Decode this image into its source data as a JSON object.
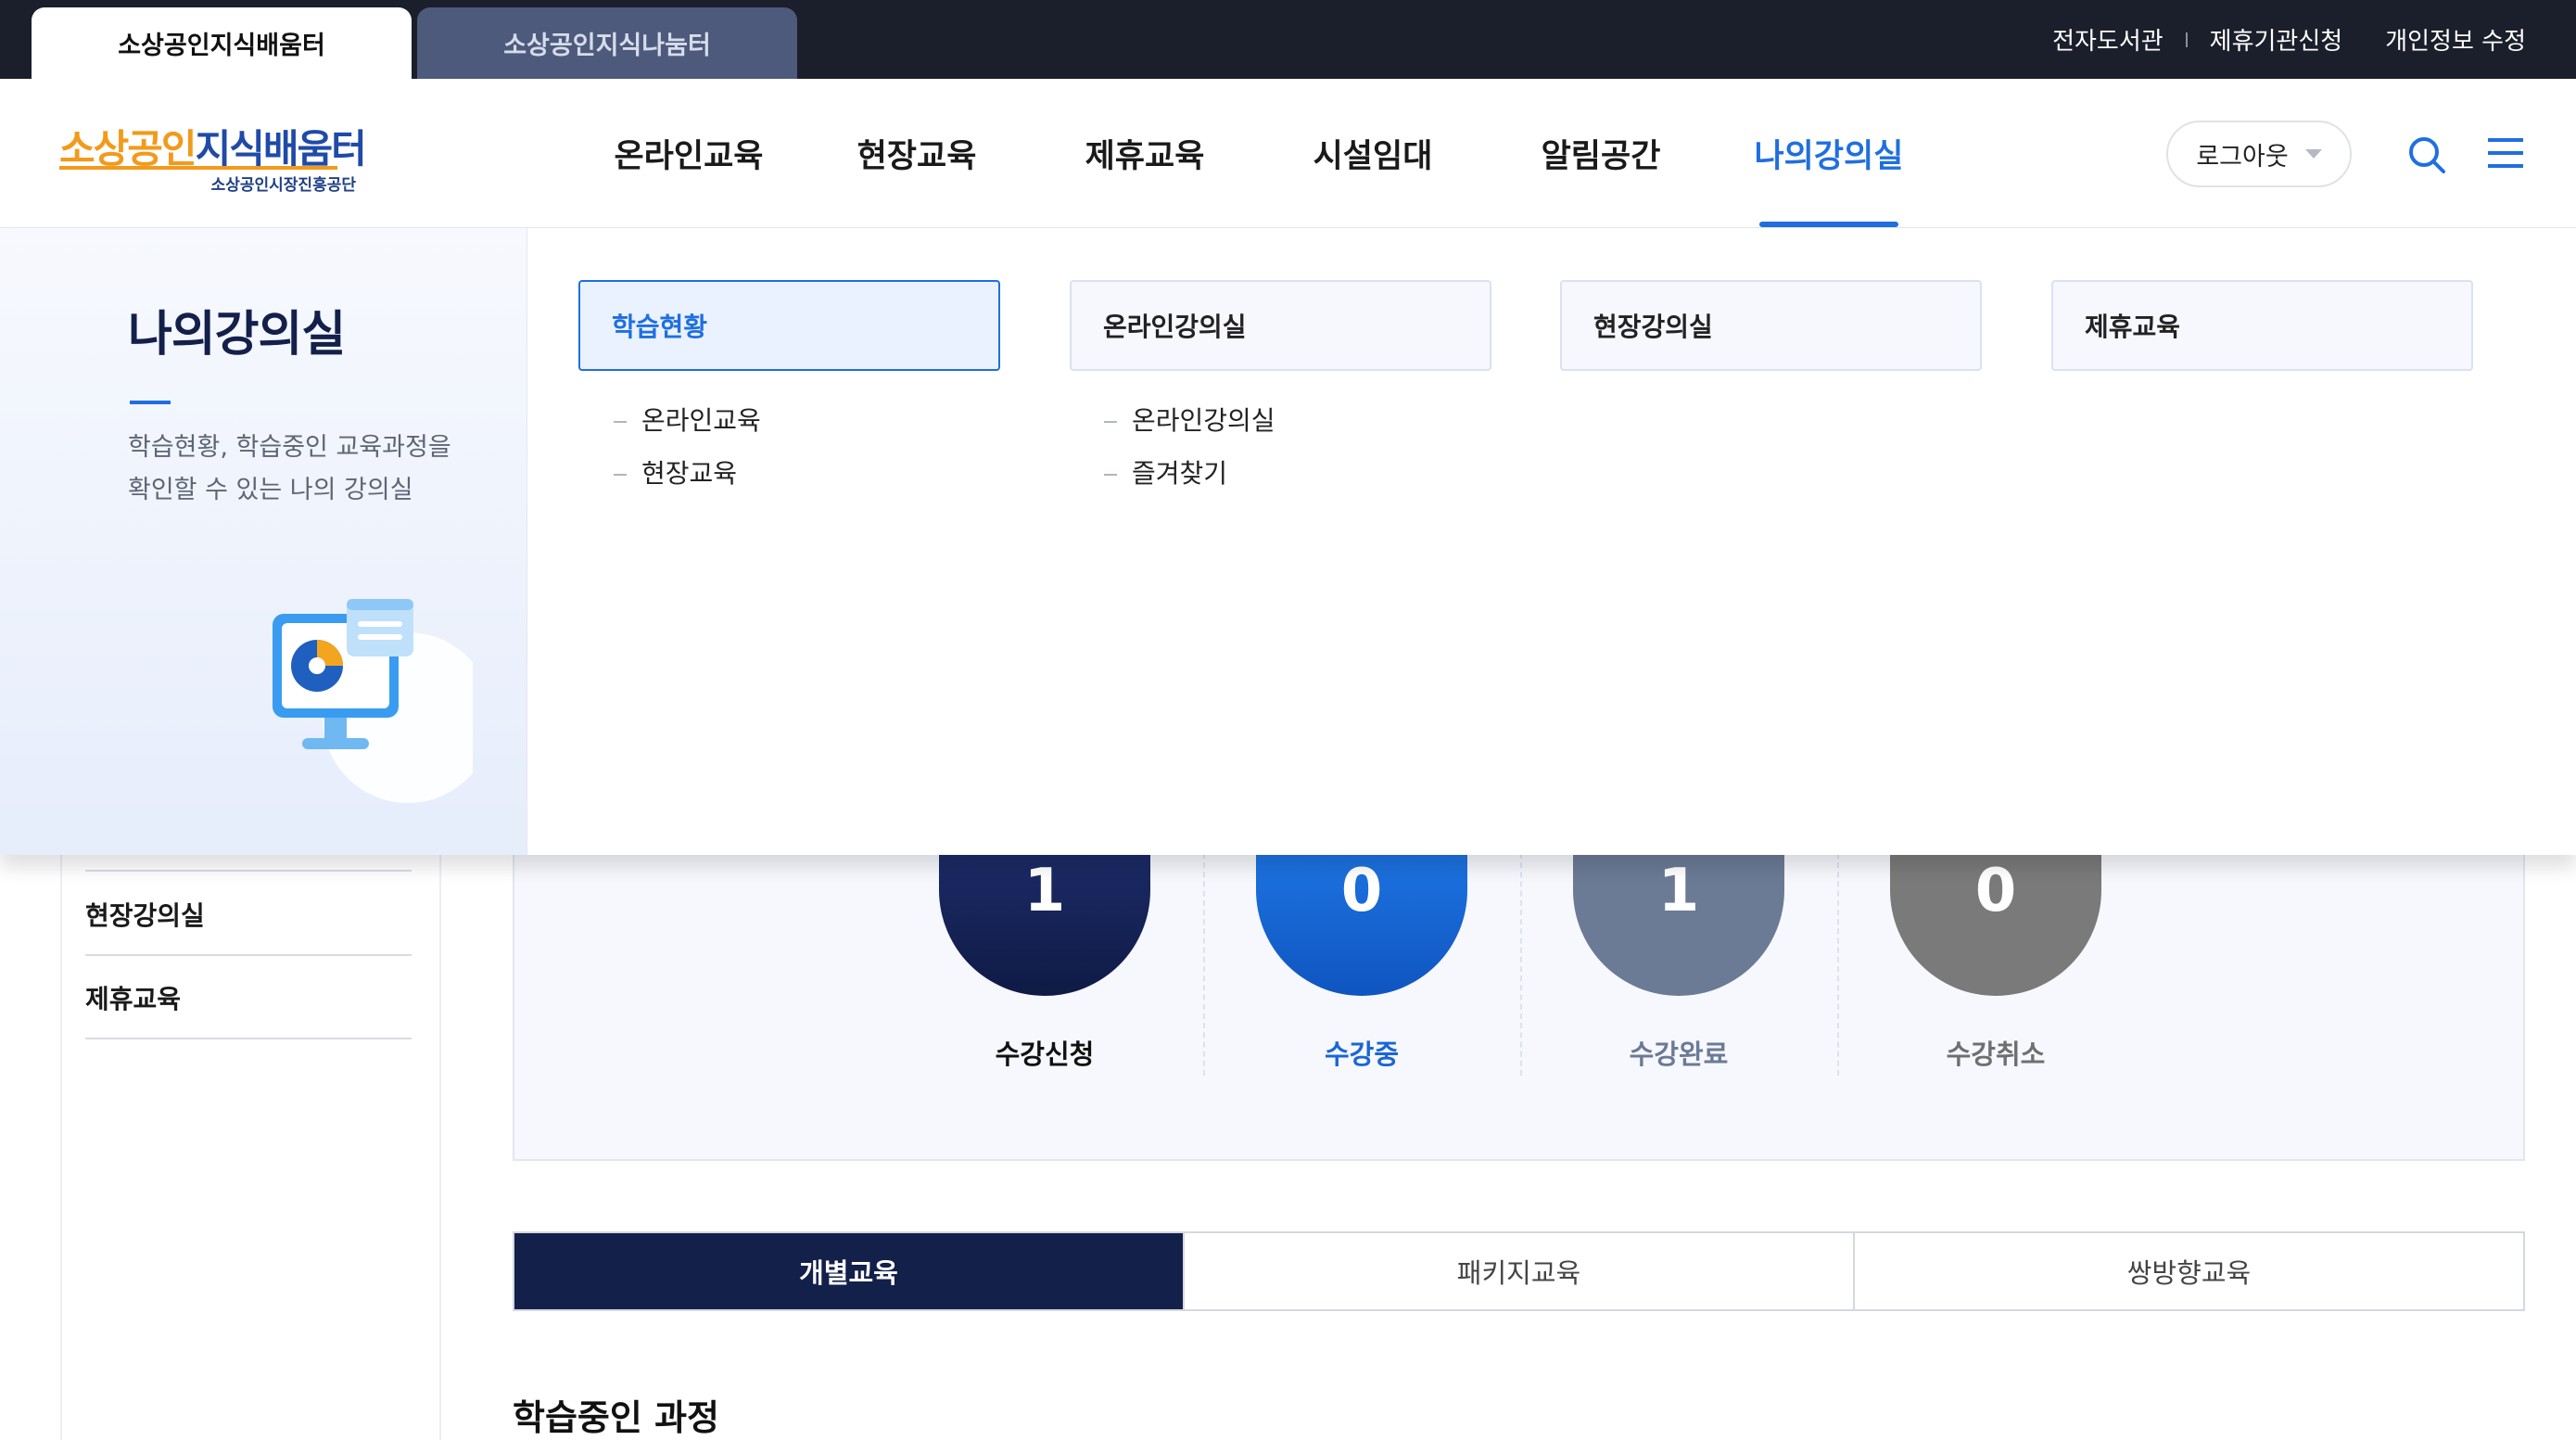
{
  "top_bar": {
    "site_tabs": [
      {
        "label": "소상공인지식배움터",
        "active": true
      },
      {
        "label": "소상공인지식나눔터",
        "active": false
      }
    ],
    "links": [
      "전자도서관",
      "제휴기관신청",
      "개인정보 수정"
    ]
  },
  "header": {
    "logo": {
      "title_part1": "소상공인",
      "title_part2": "지식배움터",
      "subtitle": "소상공인시장진흥공단"
    },
    "nav": [
      {
        "label": "온라인교육",
        "active": false
      },
      {
        "label": "현장교육",
        "active": false
      },
      {
        "label": "제휴교육",
        "active": false
      },
      {
        "label": "시설임대",
        "active": false
      },
      {
        "label": "알림공간",
        "active": false
      },
      {
        "label": "나의강의실",
        "active": true
      }
    ],
    "logout_label": "로그아웃",
    "icons": [
      "search-icon",
      "hamburger-menu-icon",
      "chevron-down-icon"
    ],
    "accent_color": "#1f6fe0"
  },
  "mega_menu": {
    "title": "나의강의실",
    "description": "학습현황, 학습중인 교육과정을 확인할 수 있는 나의 강의실",
    "illustration": "computer-monitor-icon",
    "categories": [
      {
        "label": "학습현황",
        "active": true,
        "items": [
          "온라인교육",
          "현장교육"
        ]
      },
      {
        "label": "온라인강의실",
        "active": false,
        "items": [
          "온라인강의실",
          "즐겨찾기"
        ]
      },
      {
        "label": "현장강의실",
        "active": false,
        "items": []
      },
      {
        "label": "제휴교육",
        "active": false,
        "items": []
      }
    ]
  },
  "side_nav": {
    "items": [
      "현장강의실",
      "제휴교육"
    ]
  },
  "stats": [
    {
      "label": "수강신청",
      "value": "1",
      "color": "#13204a"
    },
    {
      "label": "수강중",
      "value": "0",
      "color": "#1a66d6"
    },
    {
      "label": "수강완료",
      "value": "1",
      "color": "#6b7a95"
    },
    {
      "label": "수강취소",
      "value": "0",
      "color": "#7a7a7a"
    }
  ],
  "course_tabs": [
    {
      "label": "개별교육",
      "active": true
    },
    {
      "label": "패키지교육",
      "active": false
    },
    {
      "label": "쌍방향교육",
      "active": false
    }
  ],
  "section_title": "학습중인 과정"
}
